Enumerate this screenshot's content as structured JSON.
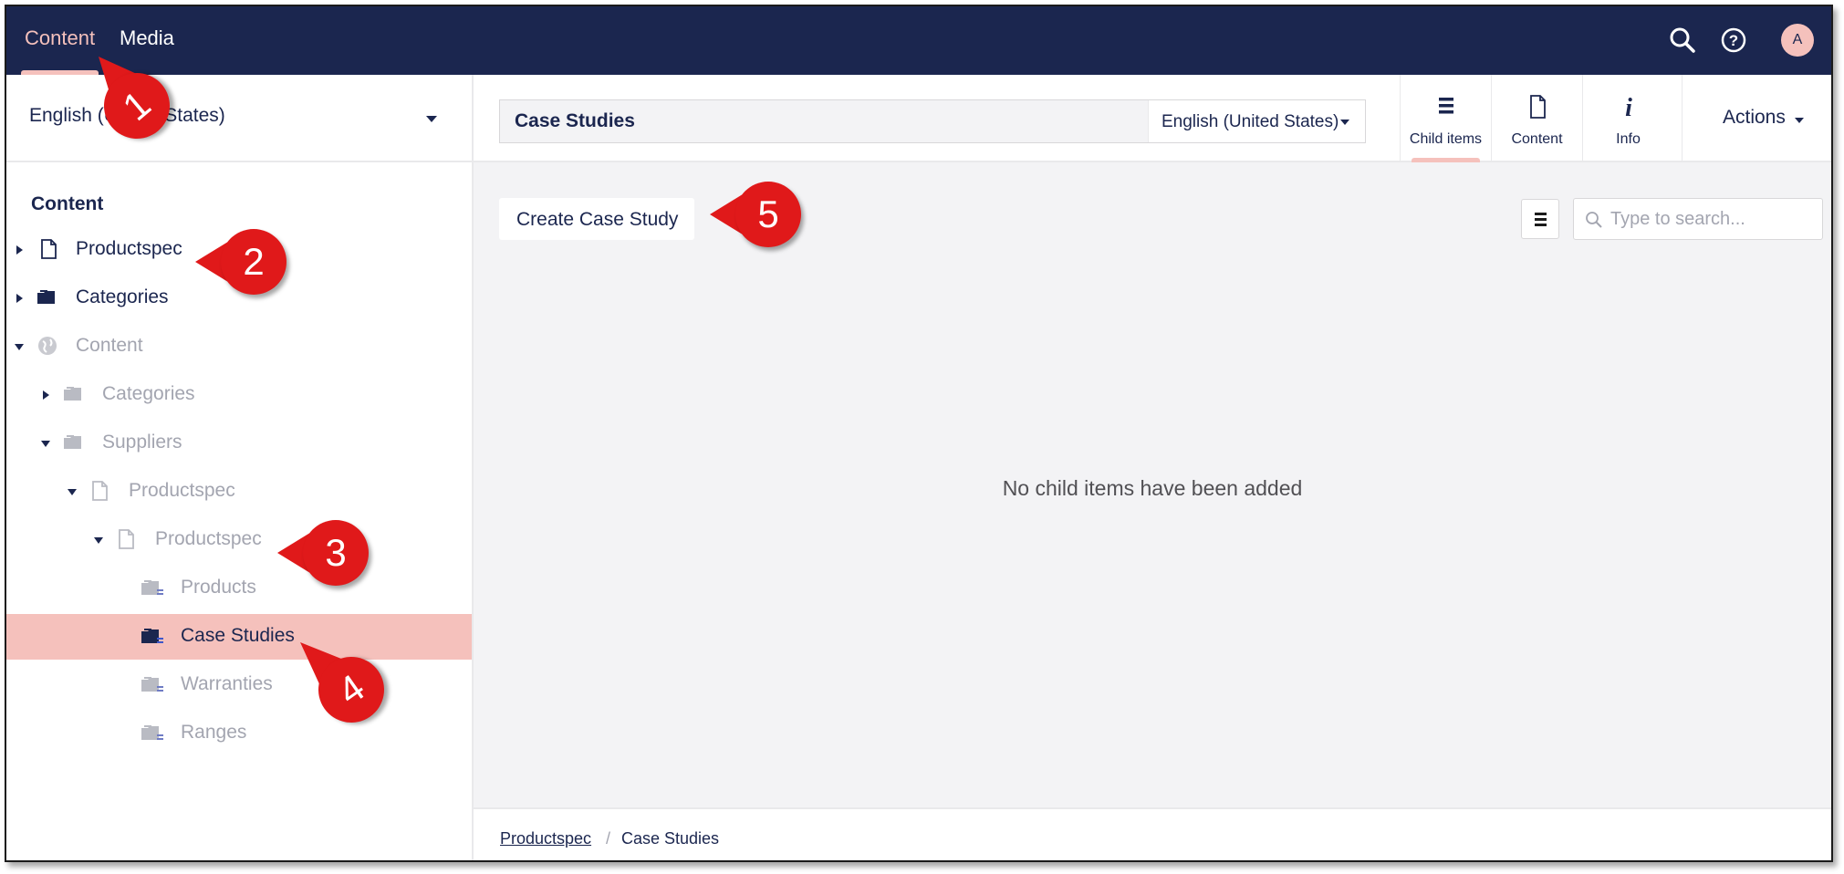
{
  "topnav": {
    "items": [
      {
        "label": "Content",
        "active": true
      },
      {
        "label": "Media",
        "active": false
      }
    ],
    "search_icon": "search-icon",
    "help_icon": "help-icon",
    "avatar_initial": "A"
  },
  "sidebar": {
    "language": "English (United States)",
    "tree_title": "Content",
    "tree": [
      {
        "label": "Productspec",
        "icon": "document-icon",
        "expanded": false
      },
      {
        "label": "Categories",
        "icon": "folder-icon",
        "expanded": false
      },
      {
        "label": "Content",
        "icon": "globe-icon",
        "expanded": true
      },
      {
        "label": "Categories",
        "icon": "folder-icon",
        "expanded": false
      },
      {
        "label": "Suppliers",
        "icon": "folder-icon",
        "expanded": true
      },
      {
        "label": "Productspec",
        "icon": "document-icon",
        "expanded": true
      },
      {
        "label": "Productspec",
        "icon": "document-icon",
        "expanded": true
      },
      {
        "label": "Products",
        "icon": "folder-list-icon"
      },
      {
        "label": "Case Studies",
        "icon": "folder-list-icon",
        "selected": true
      },
      {
        "label": "Warranties",
        "icon": "folder-list-icon"
      },
      {
        "label": "Ranges",
        "icon": "folder-list-icon"
      }
    ]
  },
  "editor": {
    "node_name": "Case Studies",
    "variant": "English (United States)",
    "apps": [
      {
        "label": "Child items",
        "icon": "list-icon",
        "active": true
      },
      {
        "label": "Content",
        "icon": "document-icon",
        "active": false
      },
      {
        "label": "Info",
        "icon": "info-icon",
        "active": false
      }
    ],
    "actions_label": "Actions"
  },
  "list_view": {
    "create_label": "Create Case Study",
    "search_placeholder": "Type to search...",
    "empty_message": "No child items have been added"
  },
  "breadcrumb": {
    "parent": "Productspec",
    "separator": "/",
    "current": "Case Studies"
  },
  "callouts": [
    "1",
    "2",
    "3",
    "4",
    "5"
  ],
  "colors": {
    "header_bg": "#1b264f",
    "accent_pink": "#f5c1bc",
    "callout_red": "#e0191a",
    "text_dark": "#1b264f",
    "text_muted": "#a3a5b0"
  }
}
